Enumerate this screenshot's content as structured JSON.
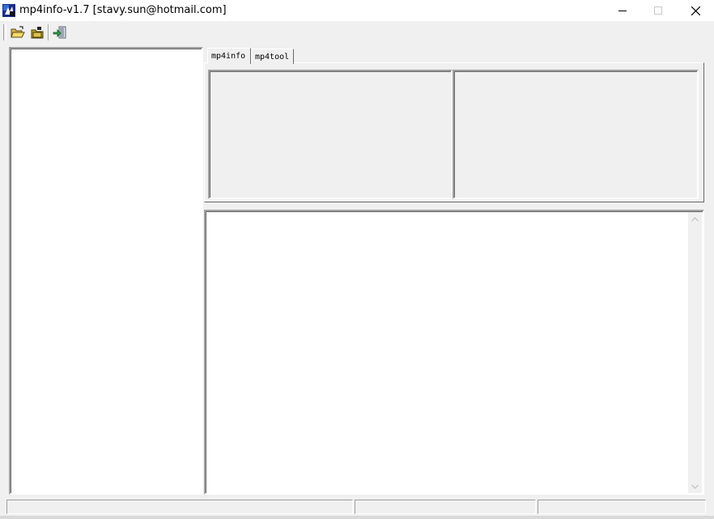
{
  "window": {
    "title": "mp4info-v1.7 [stavy.sun@hotmail.com]",
    "controls": [
      "minimize",
      "maximize",
      "close"
    ]
  },
  "toolbar": {
    "buttons": [
      {
        "icon": "open-folder-icon"
      },
      {
        "icon": "save-icon"
      },
      {
        "icon": "exit-icon"
      }
    ]
  },
  "tabs": [
    {
      "label": "mp4info",
      "active": true
    },
    {
      "label": "mp4tool",
      "active": false
    }
  ],
  "statusbar": {
    "panes": [
      "",
      "",
      ""
    ]
  }
}
